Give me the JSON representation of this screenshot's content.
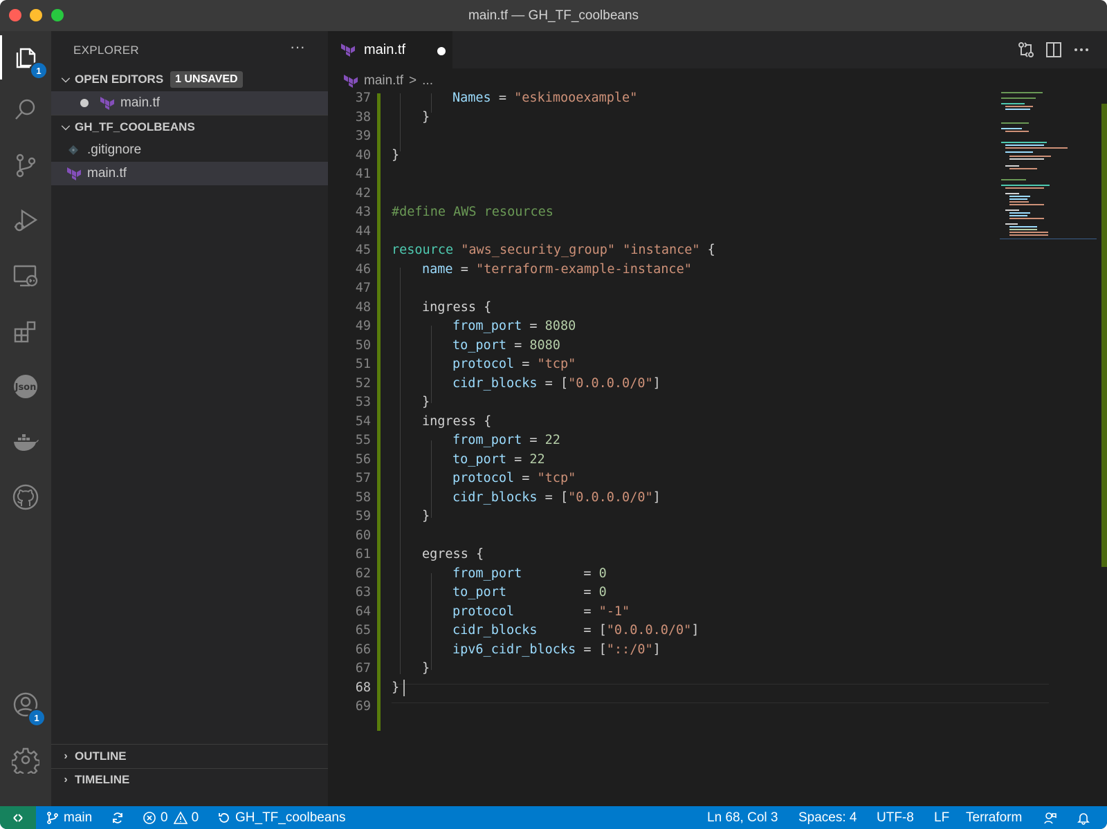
{
  "window": {
    "title": "main.tf — GH_TF_coolbeans"
  },
  "activity_bar": {
    "explorer_badge": "1",
    "accounts_badge": "1"
  },
  "sidebar": {
    "title": "EXPLORER",
    "more": "···",
    "open_editors": {
      "label": "OPEN EDITORS",
      "badge": "1 UNSAVED",
      "items": [
        {
          "name": "main.tf"
        }
      ]
    },
    "folder": {
      "label": "GH_TF_COOLBEANS",
      "items": [
        {
          "name": ".gitignore"
        },
        {
          "name": "main.tf"
        }
      ]
    },
    "outline": "OUTLINE",
    "timeline": "TIMELINE"
  },
  "tab": {
    "label": "main.tf"
  },
  "breadcrumb": {
    "file": "main.tf",
    "sep": ">",
    "rest": "..."
  },
  "code_lines": {
    "37": {
      "ln": "37",
      "t1": "Names",
      "t2": " = ",
      "t3": "\"eskimooexample\""
    },
    "38": {
      "ln": "38",
      "t1": "}"
    },
    "39": {
      "ln": "39"
    },
    "40": {
      "ln": "40",
      "t1": "}"
    },
    "41": {
      "ln": "41"
    },
    "42": {
      "ln": "42"
    },
    "43": {
      "ln": "43",
      "t1": "#define AWS resources"
    },
    "44": {
      "ln": "44"
    },
    "45": {
      "ln": "45",
      "t1": "resource",
      "t2": " ",
      "t3": "\"aws_security_group\"",
      "t4": " ",
      "t5": "\"instance\"",
      "t6": " {"
    },
    "46": {
      "ln": "46",
      "t1": "name",
      "t2": " = ",
      "t3": "\"terraform-example-instance\""
    },
    "47": {
      "ln": "47"
    },
    "48": {
      "ln": "48",
      "t1": "ingress {"
    },
    "49": {
      "ln": "49",
      "t1": "from_port",
      "t2": " = ",
      "t3": "8080"
    },
    "50": {
      "ln": "50",
      "t1": "to_port",
      "t2": " = ",
      "t3": "8080"
    },
    "51": {
      "ln": "51",
      "t1": "protocol",
      "t2": " = ",
      "t3": "\"tcp\""
    },
    "52": {
      "ln": "52",
      "t1": "cidr_blocks",
      "t2": " = [",
      "t3": "\"0.0.0.0/0\"",
      "t4": "]"
    },
    "53": {
      "ln": "53",
      "t1": "}"
    },
    "54": {
      "ln": "54",
      "t1": "ingress {"
    },
    "55": {
      "ln": "55",
      "t1": "from_port",
      "t2": " = ",
      "t3": "22"
    },
    "56": {
      "ln": "56",
      "t1": "to_port",
      "t2": " = ",
      "t3": "22"
    },
    "57": {
      "ln": "57",
      "t1": "protocol",
      "t2": " = ",
      "t3": "\"tcp\""
    },
    "58": {
      "ln": "58",
      "t1": "cidr_blocks",
      "t2": " = [",
      "t3": "\"0.0.0.0/0\"",
      "t4": "]"
    },
    "59": {
      "ln": "59",
      "t1": "}"
    },
    "60": {
      "ln": "60"
    },
    "61": {
      "ln": "61",
      "t1": "egress {"
    },
    "62": {
      "ln": "62",
      "t1": "from_port",
      "t2": "        = ",
      "t3": "0"
    },
    "63": {
      "ln": "63",
      "t1": "to_port",
      "t2": "          = ",
      "t3": "0"
    },
    "64": {
      "ln": "64",
      "t1": "protocol",
      "t2": "         = ",
      "t3": "\"-1\""
    },
    "65": {
      "ln": "65",
      "t1": "cidr_blocks",
      "t2": "      = [",
      "t3": "\"0.0.0.0/0\"",
      "t4": "]"
    },
    "66": {
      "ln": "66",
      "t1": "ipv6_cidr_blocks",
      "t2": " = [",
      "t3": "\"::/0\"",
      "t4": "]"
    },
    "67": {
      "ln": "67",
      "t1": "}"
    },
    "68": {
      "ln": "68",
      "t1": "}"
    },
    "69": {
      "ln": "69"
    }
  },
  "status_bar": {
    "branch": "main",
    "errors": "0",
    "warnings": "0",
    "workspace": "GH_TF_coolbeans",
    "position": "Ln 68, Col 3",
    "spaces": "Spaces: 4",
    "encoding": "UTF-8",
    "eol": "LF",
    "language": "Terraform"
  },
  "colors": {
    "accent": "#007acc",
    "remote": "#16825d",
    "modified_gutter": "#587c0c",
    "terraform_icon": "#844fba"
  },
  "icons": [
    "explorer-icon",
    "search-icon",
    "source-control-icon",
    "run-debug-icon",
    "remote-explorer-icon",
    "extensions-icon",
    "json-icon",
    "docker-icon",
    "github-icon",
    "accounts-icon",
    "settings-gear-icon",
    "terraform-icon",
    "git-file-icon",
    "compare-changes-icon",
    "split-editor-icon",
    "branch-icon",
    "sync-icon",
    "error-icon",
    "warning-icon",
    "feedback-icon",
    "bell-icon"
  ]
}
